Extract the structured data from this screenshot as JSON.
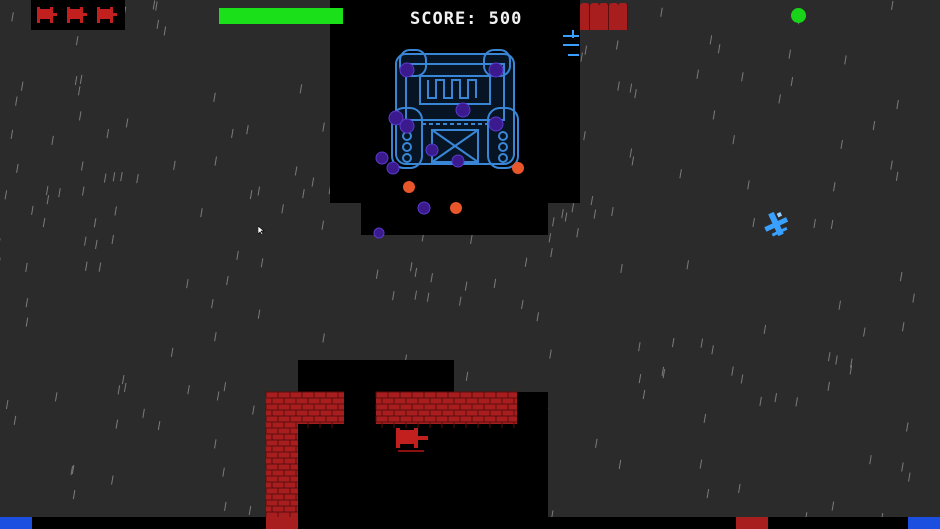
{
  "hud": {
    "score_text": "SCORE: 500",
    "health": 1.0,
    "lives": 3,
    "ammo_cells": 5,
    "status_color": "#19d519"
  },
  "colors": {
    "background": "#2b2b2b",
    "void": "#000000",
    "health": "#19e019",
    "brick": "#a81d1d",
    "boss_frame": "#3a86d6",
    "enemy_orb": "#3a1a8c",
    "fireball": "#e8562a",
    "player_ship": "#3aa0ff",
    "water": "#1a4fe0"
  },
  "icons": {
    "life": "red-tank-icon",
    "ammo": "red-shell-icon",
    "boss": "fortress-boss-icon",
    "player": "blue-jet-player-icon",
    "cursor": "mouse-cursor-icon"
  }
}
